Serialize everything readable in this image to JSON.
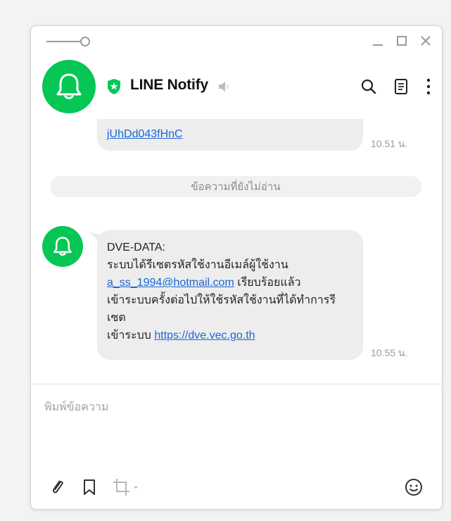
{
  "window": {
    "title": "LINE Notify",
    "controls": [
      "minimize",
      "maximize",
      "close"
    ]
  },
  "header": {
    "chat_name": "LINE Notify",
    "icons": [
      "bell-icon",
      "verified-shield-icon",
      "speaker-muted-icon",
      "search-icon",
      "notes-icon",
      "more-icon"
    ]
  },
  "messages": {
    "previous": {
      "link_text": "jUhDd043fHnC",
      "time": "10.51 น."
    },
    "unread_label": "ข้อความที่ยังไม่อ่าน",
    "latest": {
      "line1": "DVE-DATA:",
      "line2": "ระบบได้รีเซตรหัสใช้งานอีเมล์ผู้ใช้งาน",
      "email": "a_ss_1994@hotmail.com",
      "after_email": " เรียบร้อยแล้ว",
      "line4": "เข้าระบบครั้งต่อไปให้ใช้รหัสใช้งานที่ได้ทำการรี",
      "line5": "เซต",
      "line6_prefix": "เข้าระบบ ",
      "url": "https://dve.vec.go.th",
      "time": "10.55 น."
    }
  },
  "composer": {
    "placeholder": "พิมพ์ข้อความ",
    "tools": [
      "attach-icon",
      "bookmark-icon",
      "crop-icon",
      "emoji-icon"
    ]
  },
  "colors": {
    "brand_green": "#06c755",
    "link_blue": "#1a66d8",
    "bubble_gray": "#ededed"
  }
}
